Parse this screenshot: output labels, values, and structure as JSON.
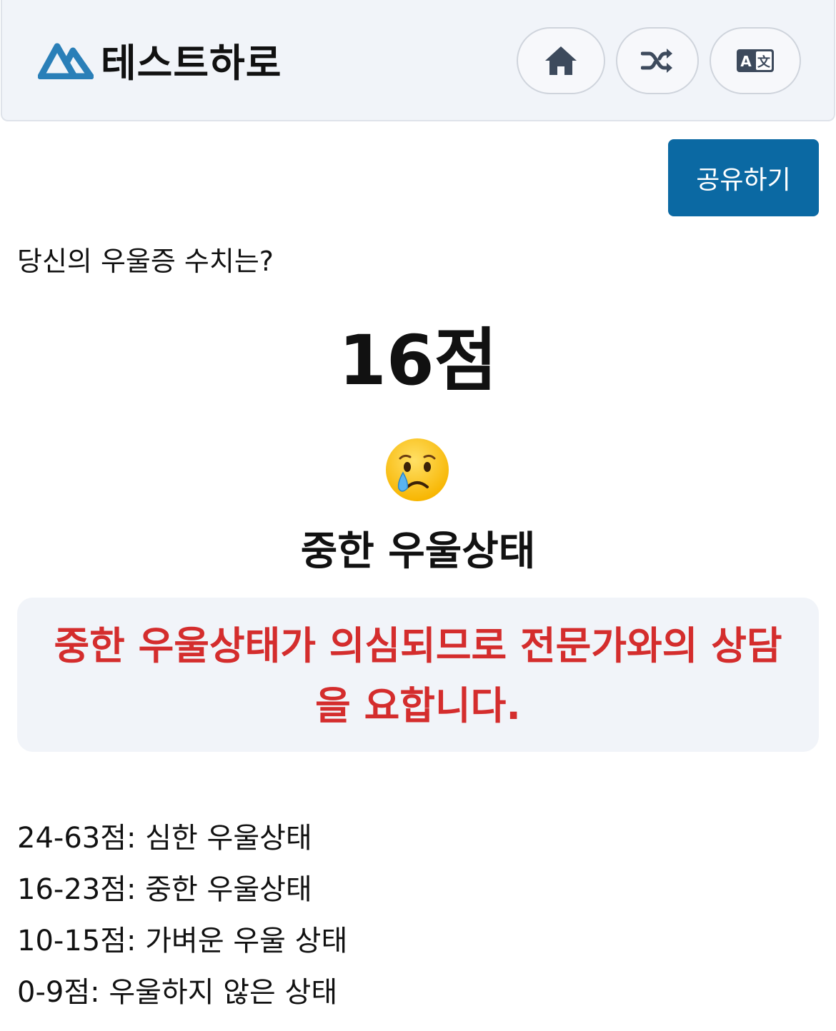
{
  "header": {
    "brand_name": "테스트하로",
    "logo_color": "#2a7fb8",
    "icons": [
      "home-icon",
      "shuffle-icon",
      "translate-icon"
    ],
    "translate_icon_text": "A文"
  },
  "share": {
    "label": "공유하기",
    "color": "#0b69a3"
  },
  "result": {
    "question": "당신의 우울증 수치는?",
    "score": "16점",
    "emoji": "crying-face-icon",
    "title": "중한 우울상태",
    "advice": "중한 우울상태가 의심되므로 전문가와의 상담을 요합니다.",
    "advice_color": "#d42d2d"
  },
  "scale": [
    "24-63점: 심한 우울상태",
    "16-23점: 중한 우울상태",
    "10-15점: 가벼운 우울 상태",
    "0-9점: 우울하지 않은 상태"
  ]
}
